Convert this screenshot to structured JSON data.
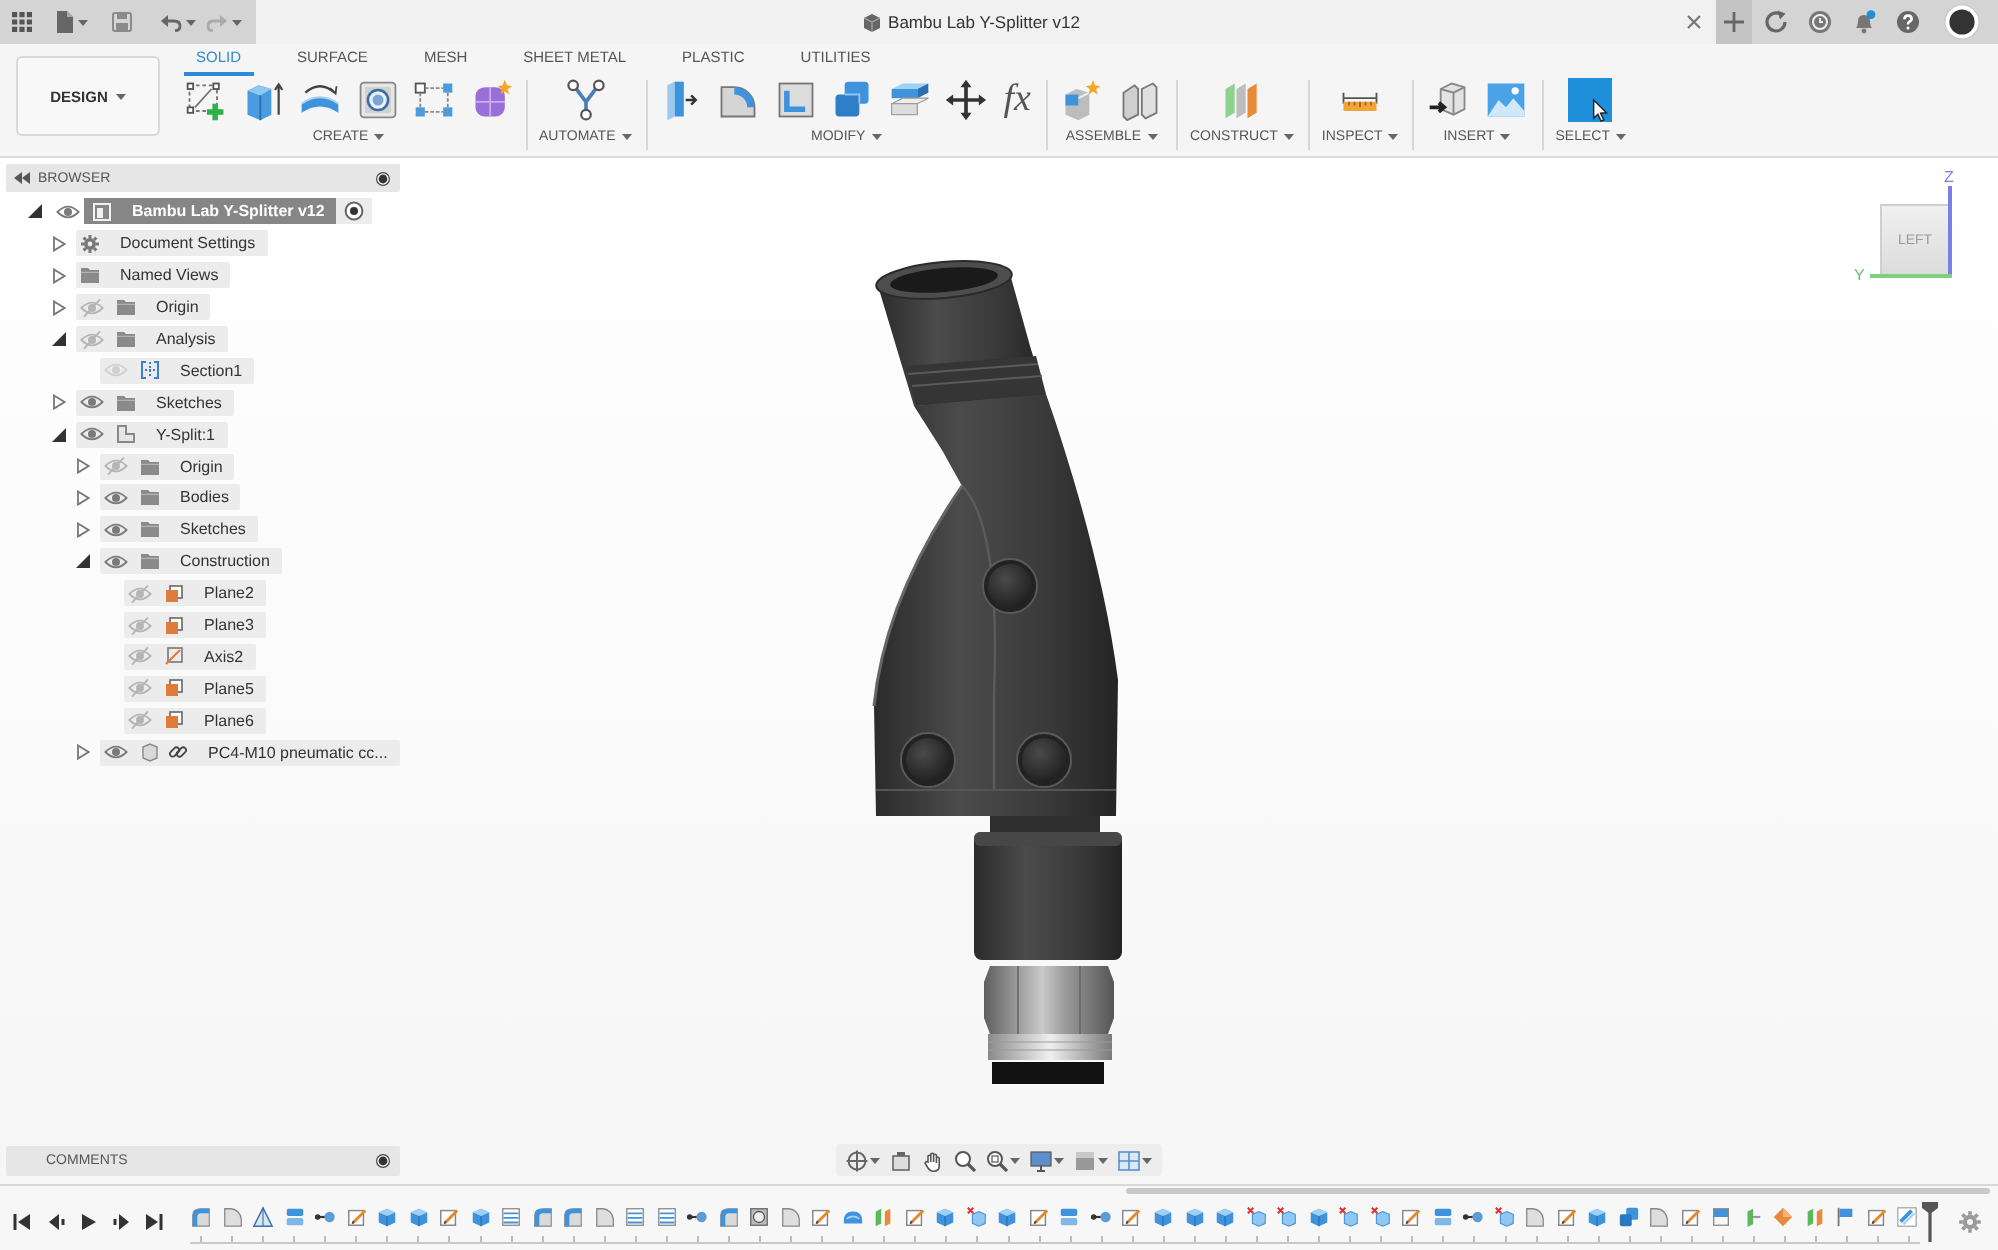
{
  "window": {
    "title": "Bambu Lab Y-Splitter v12"
  },
  "workspace": {
    "label": "DESIGN"
  },
  "tabs": [
    {
      "label": "SOLID",
      "selected": true
    },
    {
      "label": "SURFACE",
      "selected": false
    },
    {
      "label": "MESH",
      "selected": false
    },
    {
      "label": "SHEET METAL",
      "selected": false
    },
    {
      "label": "PLASTIC",
      "selected": false
    },
    {
      "label": "UTILITIES",
      "selected": false
    }
  ],
  "toolbar_groups": [
    {
      "label": "CREATE",
      "active": false
    },
    {
      "label": "AUTOMATE",
      "active": false
    },
    {
      "label": "MODIFY",
      "active": false,
      "glyph": "fx"
    },
    {
      "label": "ASSEMBLE",
      "active": false
    },
    {
      "label": "CONSTRUCT",
      "active": false
    },
    {
      "label": "INSPECT",
      "active": false
    },
    {
      "label": "INSERT",
      "active": false
    },
    {
      "label": "SELECT",
      "active": true
    }
  ],
  "browser": {
    "title": "BROWSER",
    "tree": [
      {
        "label": "Bambu Lab Y-Splitter v12",
        "kind": "document",
        "visible": true,
        "expanded": true,
        "selected": true,
        "activated": true,
        "children": [
          {
            "label": "Document Settings",
            "kind": "settings",
            "expanded": false,
            "selected": false
          },
          {
            "label": "Named Views",
            "kind": "folder",
            "expanded": false,
            "selected": false
          },
          {
            "label": "Origin",
            "kind": "folder",
            "visible": false,
            "expanded": false,
            "selected": false
          },
          {
            "label": "Analysis",
            "kind": "folder",
            "visible": false,
            "expanded": true,
            "selected": false,
            "children": [
              {
                "label": "Section1",
                "kind": "section",
                "visible": true,
                "selected": false
              }
            ]
          },
          {
            "label": "Sketches",
            "kind": "folder",
            "visible": true,
            "expanded": false,
            "selected": false
          },
          {
            "label": "Y-Split:1",
            "kind": "component",
            "visible": true,
            "expanded": true,
            "selected": false,
            "children": [
              {
                "label": "Origin",
                "kind": "folder",
                "visible": false,
                "expanded": false,
                "selected": false
              },
              {
                "label": "Bodies",
                "kind": "folder",
                "visible": true,
                "expanded": false,
                "selected": false
              },
              {
                "label": "Sketches",
                "kind": "folder",
                "visible": true,
                "expanded": false,
                "selected": false
              },
              {
                "label": "Construction",
                "kind": "folder",
                "visible": true,
                "expanded": true,
                "selected": false,
                "children": [
                  {
                    "label": "Plane2",
                    "kind": "plane",
                    "visible": false,
                    "selected": false
                  },
                  {
                    "label": "Plane3",
                    "kind": "plane",
                    "visible": false,
                    "selected": false
                  },
                  {
                    "label": "Axis2",
                    "kind": "axis",
                    "visible": false,
                    "selected": false
                  },
                  {
                    "label": "Plane5",
                    "kind": "plane",
                    "visible": false,
                    "selected": false
                  },
                  {
                    "label": "Plane6",
                    "kind": "plane",
                    "visible": false,
                    "selected": false
                  }
                ]
              },
              {
                "label": "PC4-M10 pneumatic cc...",
                "kind": "linked_component",
                "visible": true,
                "expanded": false,
                "selected": false
              }
            ]
          }
        ]
      }
    ]
  },
  "comments": {
    "title": "COMMENTS"
  },
  "viewcube": {
    "face": "LEFT",
    "z_axis": "Z",
    "y_axis": "Y"
  }
}
